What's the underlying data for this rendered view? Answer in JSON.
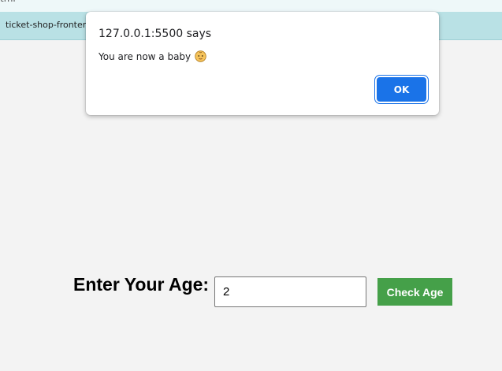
{
  "browser": {
    "url_fragment": "tml",
    "bookmark": "ticket-shop-fronten"
  },
  "alert": {
    "title": "127.0.0.1:5500 says",
    "message": "You are now a baby",
    "message_icon": "baby-face-icon",
    "ok_label": "OK",
    "accent": "#1a73e8"
  },
  "form": {
    "label": "Enter Your Age:",
    "age_value": "2",
    "submit_label": "Check Age",
    "submit_color": "#45a049"
  }
}
